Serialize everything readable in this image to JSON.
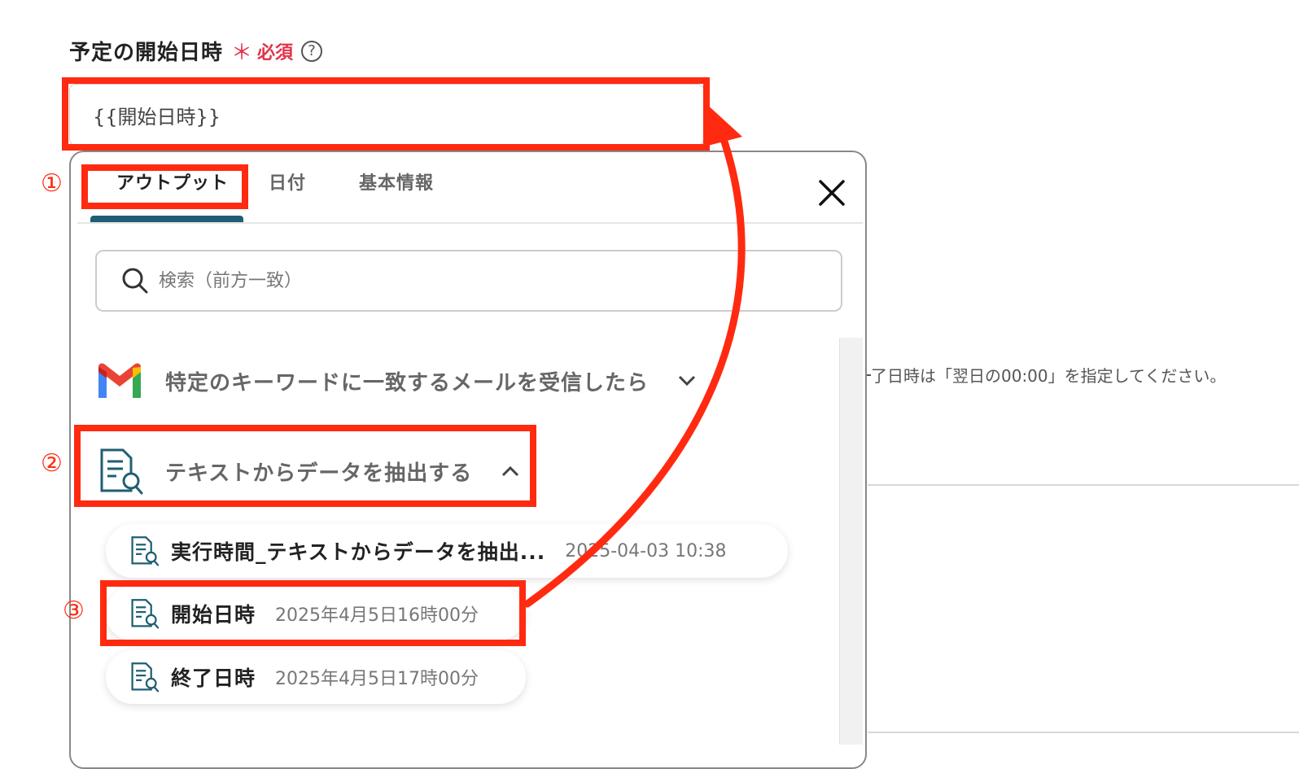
{
  "field": {
    "label": "予定の開始日時",
    "required_mark": "＊",
    "required_text": "必須",
    "help": "?",
    "value": "{{開始日時}}"
  },
  "popup": {
    "tabs": [
      "アウトプット",
      "日付",
      "基本情報"
    ],
    "active_tab": "アウトプット",
    "search_placeholder": "検索（前方一致）",
    "groups": [
      {
        "label": "特定のキーワードに一致するメールを受信したら",
        "icon": "gmail-icon",
        "expanded": false
      },
      {
        "label": "テキストからデータを抽出する",
        "icon": "document-search-icon",
        "expanded": true
      }
    ],
    "items": [
      {
        "name": "実行時間_テキストからデータを抽出...",
        "value": "2025-04-03 10:38"
      },
      {
        "name": "開始日時",
        "value": "2025年4月5日16時00分"
      },
      {
        "name": "終了日時",
        "value": "2025年4月5日17時00分"
      }
    ]
  },
  "background": {
    "hint": "了日時は「翌日の00:00」を指定してください。"
  },
  "annotations": {
    "step1": "①",
    "step2": "②",
    "step3": "③",
    "color": "#ff2a10"
  },
  "colors": {
    "accent": "#1f5f74",
    "required": "#e0334a"
  }
}
